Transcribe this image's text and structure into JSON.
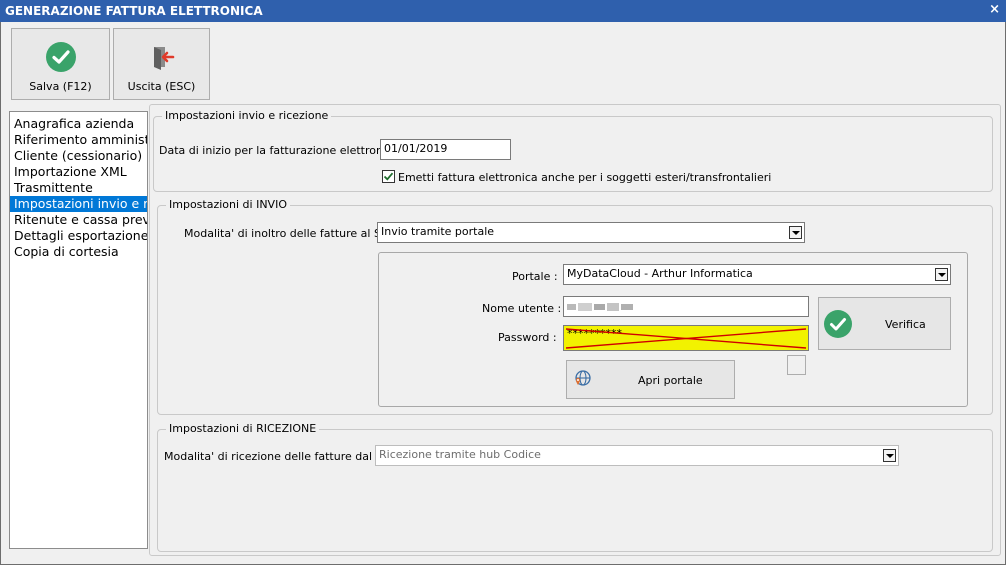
{
  "window": {
    "title": "GENERAZIONE FATTURA ELETTRONICA",
    "close_glyph": "×"
  },
  "toolbar": {
    "save_label": "Salva (F12)",
    "exit_label": "Uscita (ESC)"
  },
  "sidebar": {
    "items": [
      {
        "label": "Anagrafica azienda"
      },
      {
        "label": "Riferimento amministra"
      },
      {
        "label": "Cliente (cessionario)"
      },
      {
        "label": "Importazione XML"
      },
      {
        "label": "Trasmittente"
      },
      {
        "label": "Impostazioni invio e ric"
      },
      {
        "label": "Ritenute e cassa previd"
      },
      {
        "label": "Dettagli esportazione"
      },
      {
        "label": "Copia di cortesia"
      }
    ],
    "selected_index": 5
  },
  "general": {
    "title": "Impostazioni invio e ricezione",
    "start_date_label": "Data di inizio per la fatturazione elettronica :",
    "start_date_value": "01/01/2019",
    "foreign_checkbox_label": "Emetti fattura elettronica anche per i soggetti esteri/transfrontalieri",
    "foreign_checked": true
  },
  "invio": {
    "title": "Impostazioni di INVIO",
    "mode_label": "Modalita' di inoltro delle fatture al SDI :",
    "mode_value": "Invio tramite portale",
    "portal_label": "Portale :",
    "portal_value": "MyDataCloud - Arthur Informatica",
    "username_label": "Nome utente :",
    "password_label": "Password :",
    "password_value": "**********",
    "verify_label": "Verifica",
    "open_portal_label": "Apri portale"
  },
  "ricezione": {
    "title": "Impostazioni di RICEZIONE",
    "mode_label": "Modalita' di ricezione delle fatture dal SDI :",
    "mode_value": "Ricezione tramite hub Codice"
  },
  "colors": {
    "titlebar": "#2f60ad",
    "selection": "#0078d7",
    "accent_green": "#3aa36a",
    "password_highlight": "#f2f200",
    "strike_red": "#d00000"
  }
}
